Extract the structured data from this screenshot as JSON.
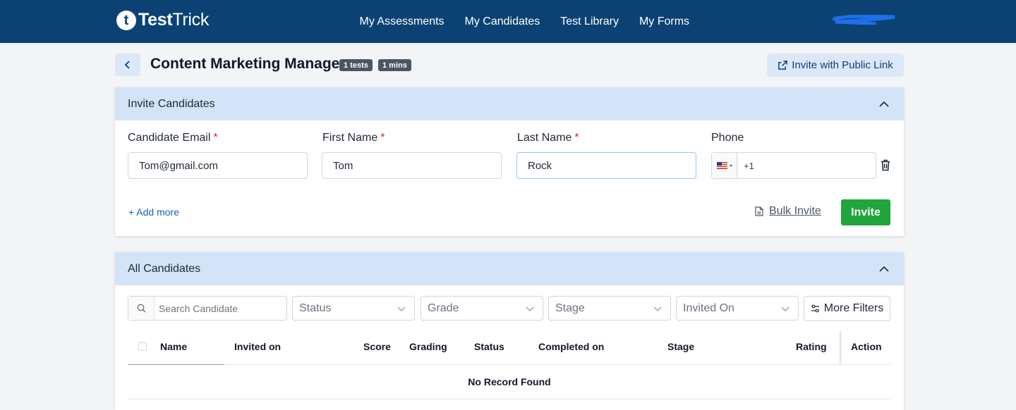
{
  "brand": {
    "mark": "t",
    "name_bold": "Test",
    "name_regular": "Trick"
  },
  "nav": [
    "My Assessments",
    "My Candidates",
    "Test Library",
    "My Forms"
  ],
  "page": {
    "title": "Content Marketing Manager",
    "badges": [
      "1 tests",
      "1 mins"
    ],
    "public_link_label": "Invite with Public Link"
  },
  "invite": {
    "header": "Invite Candidates",
    "fields": [
      {
        "label": "Candidate Email",
        "required": "*",
        "value": "Tom@gmail.com"
      },
      {
        "label": "First Name",
        "required": "*",
        "value": "Tom"
      },
      {
        "label": "Last Name",
        "required": "*",
        "value": "Rock"
      },
      {
        "label": "Phone",
        "country": "US",
        "code": "+1",
        "value": ""
      }
    ],
    "add_more": "+ Add more",
    "bulk_invite": "Bulk Invite",
    "invite_button": "Invite"
  },
  "all_candidates": {
    "header": "All Candidates",
    "search_placeholder": "Search Candidate",
    "filters": [
      "Status",
      "Grade",
      "Stage",
      "Invited On"
    ],
    "more_filters": "More Filters",
    "columns": [
      "Name",
      "Invited on",
      "Score",
      "Grading",
      "Status",
      "Completed on",
      "Stage",
      "Rating",
      "Action"
    ],
    "rows": [],
    "empty_message": "No Record Found"
  },
  "colors": {
    "topbar": "#0b4273",
    "panel_header": "#d3e3f8",
    "invite_button": "#1fa539",
    "link": "#1e5fb3",
    "required": "#dc2626"
  }
}
